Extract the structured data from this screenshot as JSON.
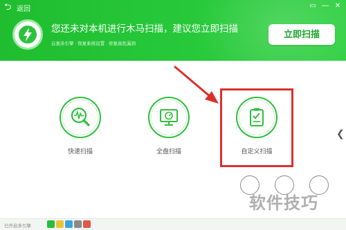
{
  "window": {
    "title": "返回",
    "controls": [
      "▭",
      "—",
      "✕"
    ]
  },
  "header": {
    "headline": "您还未对本机进行木马扫描，建议您立即扫描",
    "subline": "云查杀引擎  ·  恢复系统设置  ·  修复高危漏洞",
    "scan_now_label": "立即扫描"
  },
  "scan_options": [
    {
      "label": "快速扫描",
      "icon": "magnifier-waveform-icon"
    },
    {
      "label": "全盘扫描",
      "icon": "monitor-clock-icon"
    },
    {
      "label": "自定义扫描",
      "icon": "clipboard-check-icon"
    }
  ],
  "watermark": "软件技巧",
  "footer": {
    "status_text": "已开启多引擎"
  },
  "colors": {
    "brand_green": "#27c93a",
    "highlight_red": "#d9302c",
    "arrow_red": "#d9302c"
  }
}
